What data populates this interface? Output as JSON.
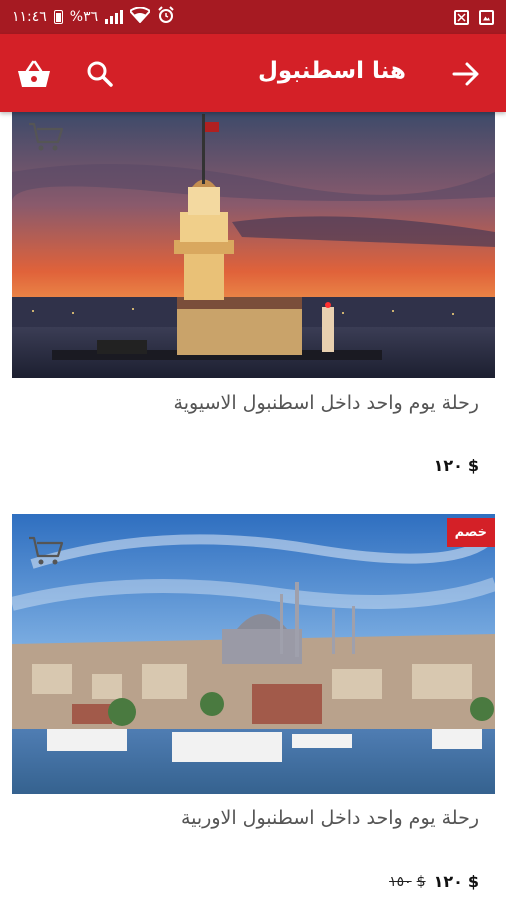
{
  "status_bar": {
    "time": "١١:٤٦",
    "battery_percent": "%٣٦",
    "icons": [
      "battery-icon",
      "signal-icon",
      "wifi-icon",
      "alarm-icon",
      "screenshot-icon",
      "image-icon"
    ]
  },
  "header": {
    "title": "هنا اسطنبول",
    "icons": [
      "basket-icon",
      "search-icon",
      "back-arrow-icon"
    ]
  },
  "products": [
    {
      "name": "رحلة يوم واحد داخل اسطنبول الاسيوية",
      "price": "١٢٠",
      "currency": "$",
      "old_price": "",
      "badge": ""
    },
    {
      "name": "رحلة يوم واحد داخل اسطنبول الاوربية",
      "price": "١٢٠",
      "currency": "$",
      "old_price": "١٥٠",
      "old_currency": "$",
      "badge": "خصم"
    }
  ],
  "colors": {
    "status_bar": "#a61a22",
    "app_bar": "#d42027",
    "badge": "#d42027"
  }
}
